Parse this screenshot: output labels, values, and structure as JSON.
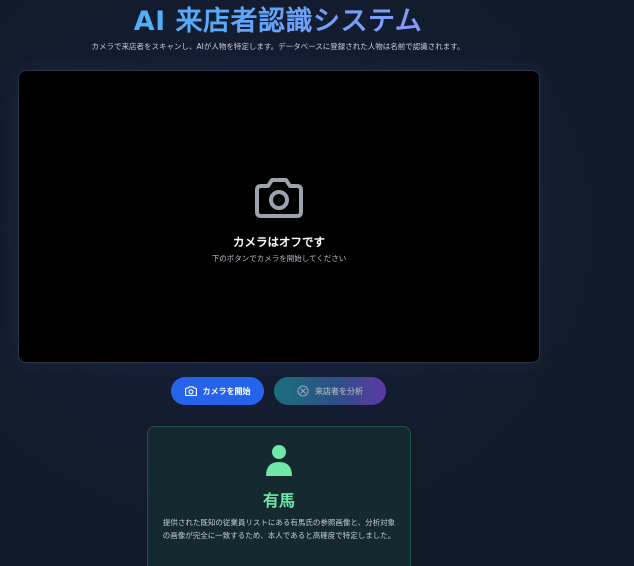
{
  "header": {
    "title": "AI 来店者認識システム",
    "subtitle": "カメラで来店者をスキャンし、AIが人物を特定します。データベースに登録された人物は名前で認識されます。"
  },
  "camera": {
    "icon": "camera-icon",
    "status_title": "カメラはオフです",
    "status_hint": "下のボタンでカメラを開始してください"
  },
  "controls": {
    "start_label": "カメラを開始",
    "start_icon": "camera-icon",
    "analyze_label": "来店者を分析",
    "analyze_icon": "circle-x-icon"
  },
  "result": {
    "icon": "person-icon",
    "name": "有馬",
    "description": "提供された既知の従業員リストにある有馬氏の参照画像と、分析対象の画像が完全に一致するため、本人であると高確度で特定しました。"
  },
  "colors": {
    "background": "#121a29",
    "accent_blue": "#2563eb",
    "success_green": "#6ee7a8"
  }
}
